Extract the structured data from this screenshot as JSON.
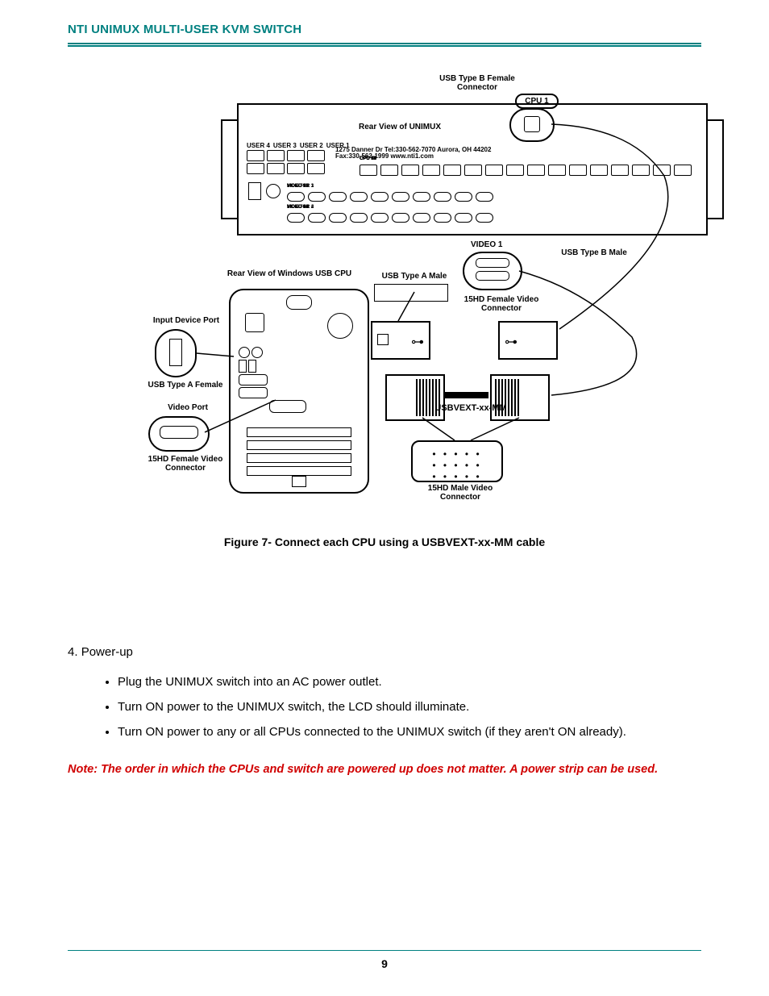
{
  "header": {
    "title": "NTI UNIMUX MULTI-USER KVM SWITCH"
  },
  "page_number": "9",
  "figure": {
    "caption": "Figure 7- Connect each CPU using a USBVEXT-xx-MM cable",
    "labels": {
      "usb_b_female": "USB Type B\nFemale Connector",
      "cpu1_tag": "CPU 1",
      "rear_unimux": "Rear View of UNIMUX",
      "users": [
        "USER 4",
        "USER 3",
        "USER 2",
        "USER 1"
      ],
      "cpu_ports": [
        "CPU 16",
        "CPU 15",
        "CPU 14",
        "CPU 13",
        "CPU 12",
        "CPU 11",
        "CPU 10",
        "CPU 9",
        "CPU 8",
        "CPU 7",
        "CPU 6",
        "CPU 5",
        "CPU 4",
        "CPU 3",
        "CPU 2",
        "CPU 1"
      ],
      "monitor_row1": [
        "MONITOR 3",
        "MONITOR 1",
        "VIDEO 15",
        "VIDEO 13",
        "VIDEO 11",
        "VIDEO 9",
        "VIDEO 7",
        "VIDEO 5",
        "VIDEO 3",
        "VIDEO 1"
      ],
      "monitor_row2": [
        "MONITOR 4",
        "MONITOR 2",
        "VIDEO 16",
        "VIDEO 14",
        "VIDEO 12",
        "VIDEO 10",
        "VIDEO 8",
        "VIDEO 6",
        "VIDEO 4",
        "VIDEO 2"
      ],
      "nti_block": "1275 Danner Dr   Tel:330-562-7070\nAurora, OH 44202   Fax:330-562-1999\nwww.nti1.com",
      "video1": "VIDEO 1",
      "usb_b_male": "USB Type B\nMale",
      "rear_pc": "Rear View of Windows USB CPU",
      "usb_a_male": "USB Type A Male",
      "hd15_female": "15HD Female\nVideo Connector",
      "input_port": "Input Device Port",
      "usb_a_female": "USB Type A Female",
      "video_port": "Video Port",
      "hd15_female2": "15HD Female\nVideo Connector",
      "cable": "USBVEXT-xx-MM",
      "hd15_male": "15HD Male\nVideo Connector"
    }
  },
  "section": {
    "number": "4.",
    "title": "Power-up",
    "bullets": [
      "Plug the UNIMUX switch into an AC power outlet.",
      "Turn ON power to the UNIMUX switch, the LCD should illuminate.",
      "Turn ON power to any or all CPUs connected to the UNIMUX switch (if they aren't ON already)."
    ]
  },
  "note": "Note:  The order in which the CPUs and switch are powered up does not matter.  A power strip can be used."
}
